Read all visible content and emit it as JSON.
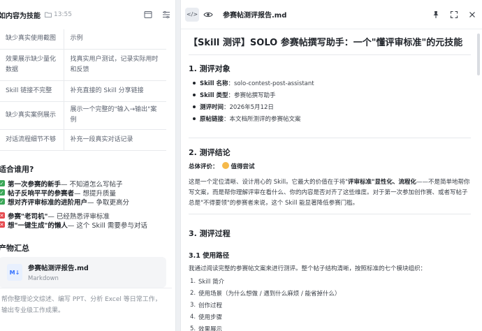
{
  "left": {
    "title": "如内容为技能",
    "time": "13:55",
    "table": [
      {
        "problem": "缺少真实使用截图",
        "fix": "示例"
      },
      {
        "problem": "效果展示缺少量化数据",
        "fix": "找真实用户测试，记录实际用时和反馈"
      },
      {
        "problem": "Skill 链接不完整",
        "fix": "补充直接的 Skill 分享链接"
      },
      {
        "problem": "缺少真实案例展示",
        "fix": "展示一个完整的\"输入→输出\"案例"
      },
      {
        "problem": "对话流程细节不够",
        "fix": "补充一段真实对话记录"
      }
    ],
    "audience_heading": "适合谁用?",
    "audience": [
      {
        "mark": "yes",
        "bold": "第一次参赛的新手",
        "rest": " — 不知道怎么写帖子"
      },
      {
        "mark": "yes",
        "bold": "帖子反响平平的参赛者",
        "rest": " — 想提升质量"
      },
      {
        "mark": "yes",
        "bold": "想对齐评审标准的进阶用户",
        "rest": " — 争取更高分"
      },
      {
        "mark": "no",
        "bold": "参赛\"老司机\"",
        "rest": " — 已经熟悉评审标准"
      },
      {
        "mark": "no",
        "bold": "想\"一键生成\"的懒人",
        "rest": " — 这个 Skill 需要参与对话"
      }
    ],
    "output_heading": "产物汇总",
    "file": {
      "badge": "M↓",
      "name": "参赛帖测评报告.md",
      "type": "Markdown"
    },
    "input_placeholder": "帮你整理论文综述、编写 PPT、分析 Excel 等日常工作，输出专业级工作成果。"
  },
  "right": {
    "filename": "参赛帖测评报告.md",
    "code_label": "</>",
    "title": "【Skill 测评】SOLO 参赛帖撰写助手：一个\"懂评审标准\"的元技能",
    "s1_heading": "1. 测评对象",
    "s1_items": [
      {
        "k": "Skill 名称",
        "v": "：solo-contest-post-assistant"
      },
      {
        "k": "Skill 类型",
        "v": "：参赛帖撰写助手"
      },
      {
        "k": "测评时间",
        "v": "：2026年5月12日"
      },
      {
        "k": "原帖链接",
        "v": "：本文档所测评的参赛帖文案"
      }
    ],
    "s2_heading": "2. 测评结论",
    "rating_label": "总体评价：",
    "rating_value": "值得尝试",
    "s2_para_a": "这是一个定位清晰、设计用心的 Skill。它最大的价值在于将\"",
    "s2_para_b": "评审标准\"显性化、流程化",
    "s2_para_c": "——不是简单地帮你写文案，而是帮你理解评审在看什么、你的内容是否对齐了这些维度。对于第一次参加创作赛、或者写帖子总是\"不得要领\"的参赛者来说，这个 Skill 能显著降低参赛门槛。",
    "s3_heading": "3. 测评过程",
    "s31_heading": "3.1 使用路径",
    "s31_para": "我通过阅读完整的参赛帖文案来进行测评。整个帖子结构清晰，按照标准的七个模块组织：",
    "s31_steps": [
      "Skill 简介",
      "使用场景（为什么想做 / 遇到什么麻烦 / 能省掉什么）",
      "创作过程",
      "使用步骤",
      "效果展示"
    ]
  }
}
